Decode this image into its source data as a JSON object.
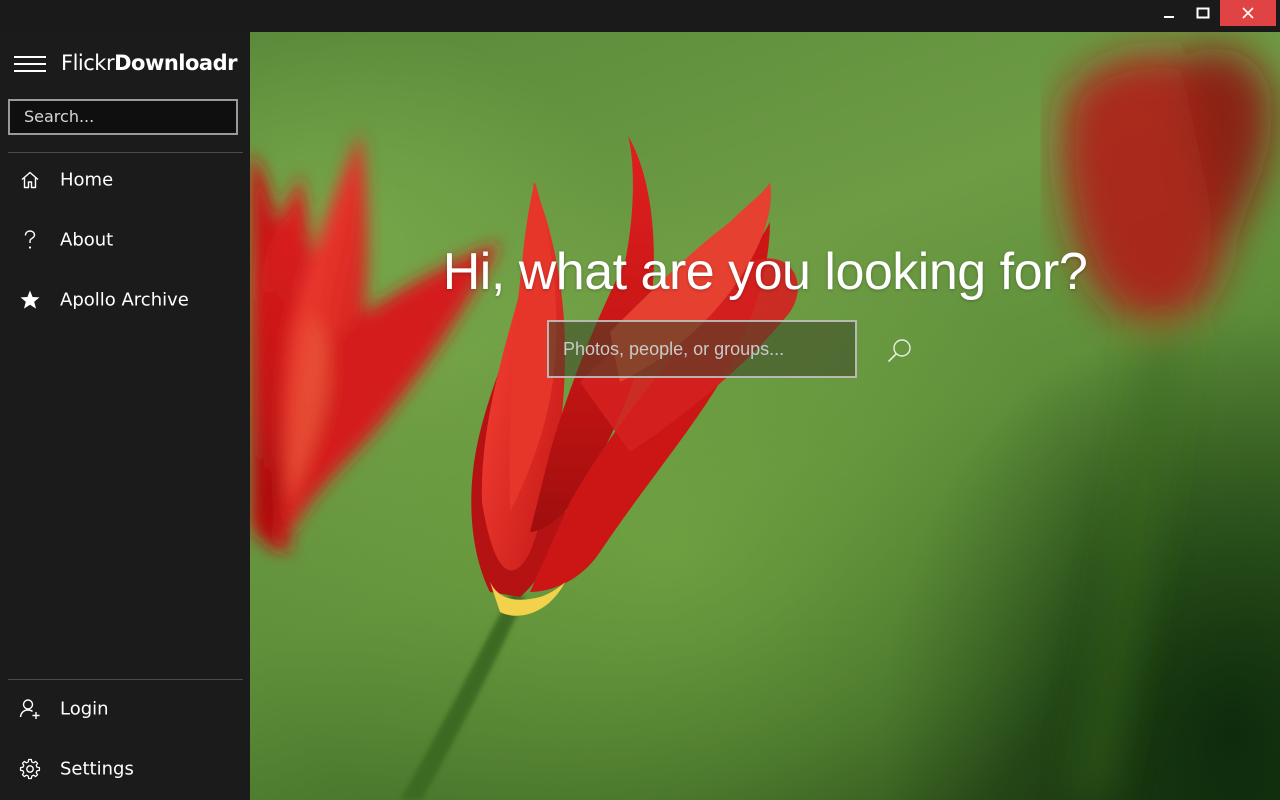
{
  "window": {
    "minimize_icon": "minimize-icon",
    "maximize_icon": "maximize-icon",
    "close_icon": "close-icon",
    "close_color": "#e04343"
  },
  "sidebar": {
    "app_title_light": "Flickr",
    "app_title_bold": "Downloadr",
    "search_placeholder": "Search...",
    "nav_items": [
      {
        "label": "Home",
        "icon": "home-icon"
      },
      {
        "label": "About",
        "icon": "question-icon"
      },
      {
        "label": "Apollo Archive",
        "icon": "star-icon"
      }
    ],
    "bottom_items": [
      {
        "label": "Login",
        "icon": "add-user-icon"
      },
      {
        "label": "Settings",
        "icon": "gear-icon"
      }
    ],
    "background": "#1b1b1b"
  },
  "hero": {
    "heading": "Hi, what are you looking for?",
    "search_placeholder": "Photos, people, or groups...",
    "search_icon": "search-icon",
    "background_image": "red tulips on green background"
  }
}
